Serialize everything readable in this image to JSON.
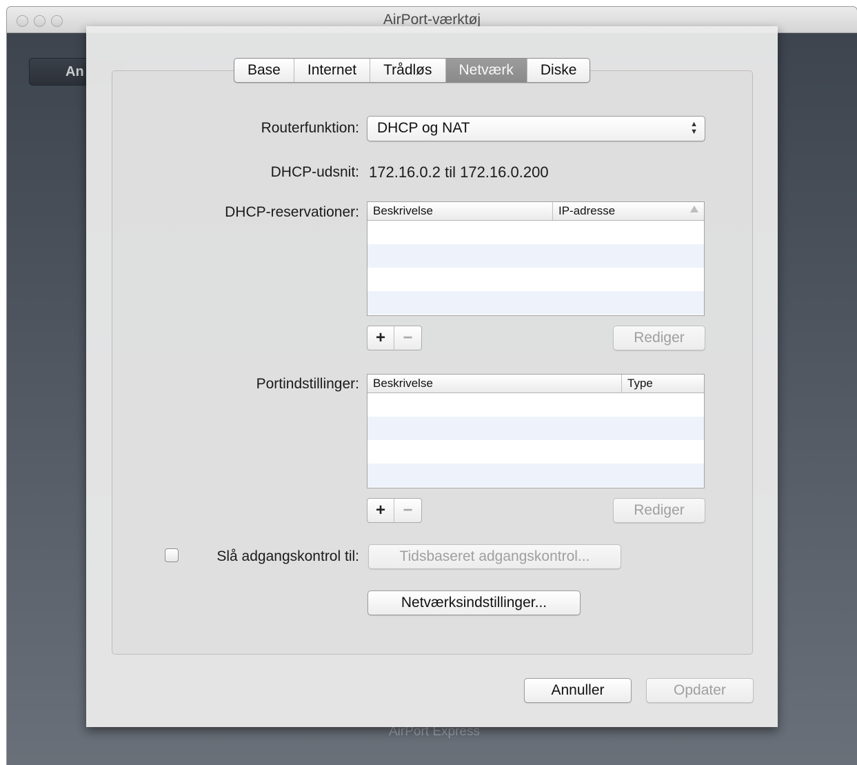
{
  "window": {
    "title": "AirPort-værktøj",
    "background_button_label": "An",
    "background_device_label": "AirPort Express"
  },
  "tabs": [
    {
      "label": "Base",
      "selected": false
    },
    {
      "label": "Internet",
      "selected": false
    },
    {
      "label": "Trådløs",
      "selected": false
    },
    {
      "label": "Netværk",
      "selected": true
    },
    {
      "label": "Diske",
      "selected": false
    }
  ],
  "router": {
    "label": "Routerfunktion:",
    "value": "DHCP og NAT"
  },
  "dhcp_range": {
    "label": "DHCP-udsnit:",
    "value": "172.16.0.2 til 172.16.0.200"
  },
  "dhcp_reservations": {
    "label": "DHCP-reservationer:",
    "columns": [
      "Beskrivelse",
      "IP-adresse"
    ],
    "edit_label": "Rediger",
    "add_label": "+",
    "remove_label": "−"
  },
  "port_settings": {
    "label": "Portindstillinger:",
    "columns": [
      "Beskrivelse",
      "Type"
    ],
    "edit_label": "Rediger",
    "add_label": "+",
    "remove_label": "−"
  },
  "access_control": {
    "checkbox_label": "Slå adgangskontrol til:",
    "checked": false,
    "button_label": "Tidsbaseret adgangskontrol..."
  },
  "network_settings_button": "Netværksindstillinger...",
  "footer": {
    "cancel_label": "Annuller",
    "update_label": "Opdater"
  },
  "colors": {
    "selected_tab": "#8f8f8f",
    "table_alt_row": "#eef3fb",
    "disabled_text": "#9f9f9f"
  }
}
